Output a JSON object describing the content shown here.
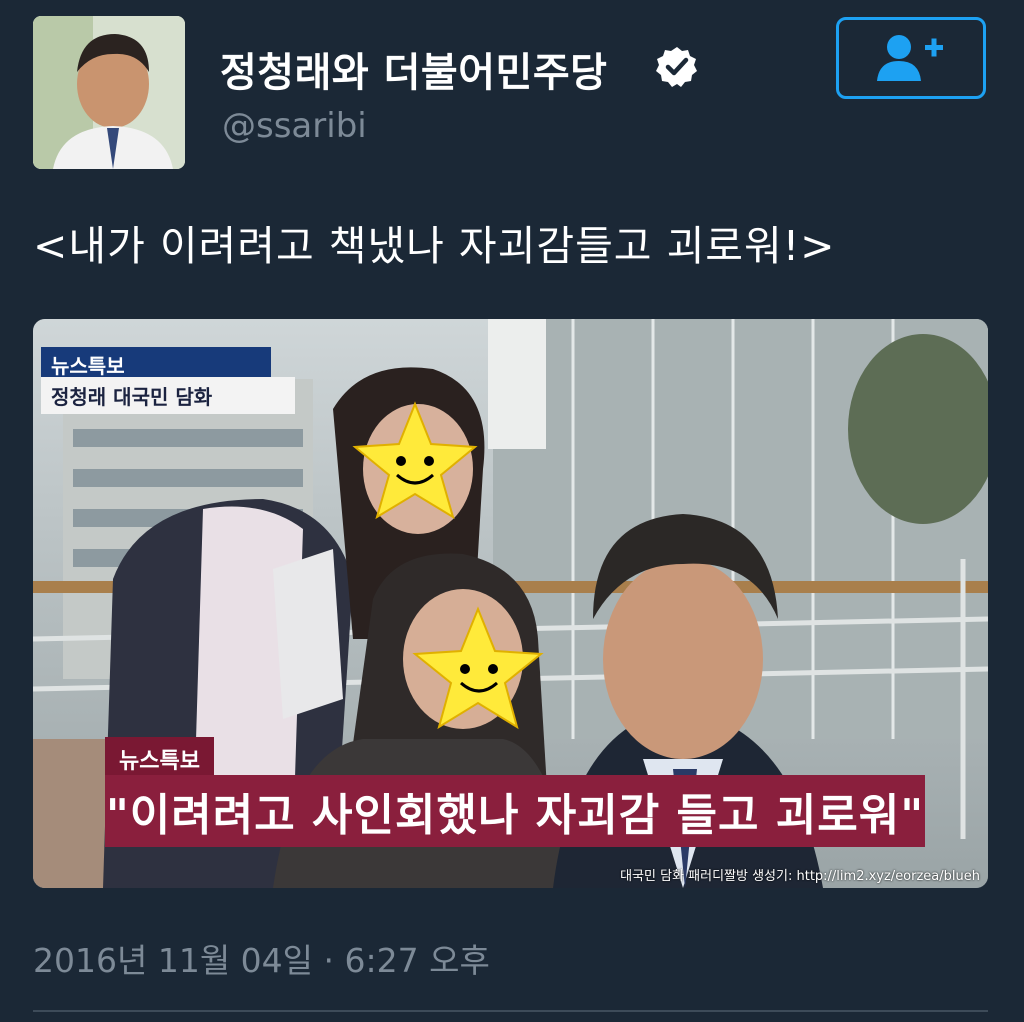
{
  "profile": {
    "display_name": "정청래와 더불어민주당",
    "handle": "@ssaribi",
    "verified": true,
    "follow_icon": "add-user-icon"
  },
  "tweet": {
    "text": "<내가 이려려고 책냈나 자괴감들고 괴로워!>",
    "timestamp": "2016년 11월 04일 · 6:27 오후"
  },
  "media": {
    "top_tag": "뉴스특보",
    "top_subtitle": "정청래 대국민 담화",
    "bottom_tag": "뉴스특보",
    "headline": "\"이려려고 사인회했나 자괴감 들고 괴로워\"",
    "credit": "대국민 담화 패러디짤방 생성기: http://lim2.xyz/eorzea/blueh"
  },
  "colors": {
    "background": "#1b2836",
    "accent": "#1da1f2",
    "muted_text": "#7d8a97",
    "headline_bar": "#8a1f3d",
    "news_blue": "#173a7a"
  }
}
